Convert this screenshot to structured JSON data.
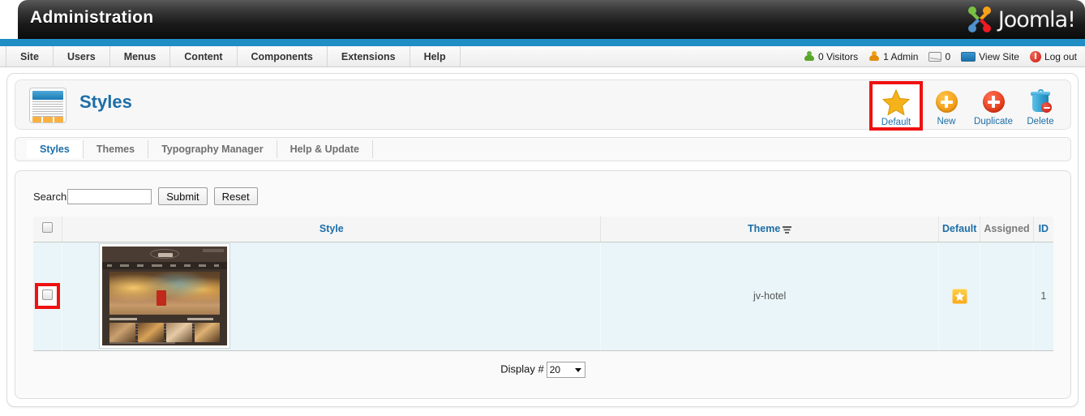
{
  "header": {
    "title": "Administration",
    "brand": "Joomla!",
    "brand_icon": "joomla-logo-icon"
  },
  "menubar": {
    "items": [
      {
        "label": "Site"
      },
      {
        "label": "Users"
      },
      {
        "label": "Menus"
      },
      {
        "label": "Content"
      },
      {
        "label": "Components"
      },
      {
        "label": "Extensions"
      },
      {
        "label": "Help"
      }
    ],
    "status": [
      {
        "icon": "visitors-person-icon",
        "label": "0 Visitors"
      },
      {
        "icon": "admin-person-icon",
        "label": "1 Admin"
      },
      {
        "icon": "messages-mail-icon",
        "label": "0"
      },
      {
        "icon": "view-site-monitor-icon",
        "label": "View Site"
      },
      {
        "icon": "logout-power-icon",
        "label": "Log out"
      }
    ]
  },
  "page": {
    "title": "Styles",
    "title_icon": "template-styles-icon"
  },
  "toolbar": {
    "buttons": [
      {
        "label": "Default",
        "icon": "star-icon",
        "highlighted": true
      },
      {
        "label": "New",
        "icon": "plus-circle-orange-icon",
        "highlighted": false
      },
      {
        "label": "Duplicate",
        "icon": "plus-circle-red-icon",
        "highlighted": false
      },
      {
        "label": "Delete",
        "icon": "trash-icon",
        "highlighted": false
      }
    ]
  },
  "tabs": [
    {
      "label": "Styles",
      "active": true
    },
    {
      "label": "Themes",
      "active": false
    },
    {
      "label": "Typography Manager",
      "active": false
    },
    {
      "label": "Help & Update",
      "active": false
    }
  ],
  "search": {
    "label": "Search",
    "value": "",
    "placeholder": "",
    "submit_label": "Submit",
    "reset_label": "Reset"
  },
  "table": {
    "columns": [
      {
        "key": "checkbox",
        "label": ""
      },
      {
        "key": "style",
        "label": "Style"
      },
      {
        "key": "theme",
        "label": "Theme",
        "sort_icon": "sort-descending-icon"
      },
      {
        "key": "default",
        "label": "Default"
      },
      {
        "key": "assigned",
        "label": "Assigned"
      },
      {
        "key": "id",
        "label": "ID"
      }
    ],
    "rows": [
      {
        "checked": false,
        "checkbox_highlighted": true,
        "style_thumbnail": "hotel-template-preview",
        "theme": "jv-hotel",
        "default": true,
        "default_icon": "star-badge-icon",
        "assigned": "",
        "id": "1"
      }
    ]
  },
  "footer": {
    "display_label": "Display #",
    "display_value": "20"
  },
  "colors": {
    "accent_blue": "#1c6ea8",
    "bar_blue": "#1f8ec4",
    "highlight_red": "#ef1111",
    "row_bg": "#e9f5f8",
    "star_yellow": "#f9a91c"
  }
}
